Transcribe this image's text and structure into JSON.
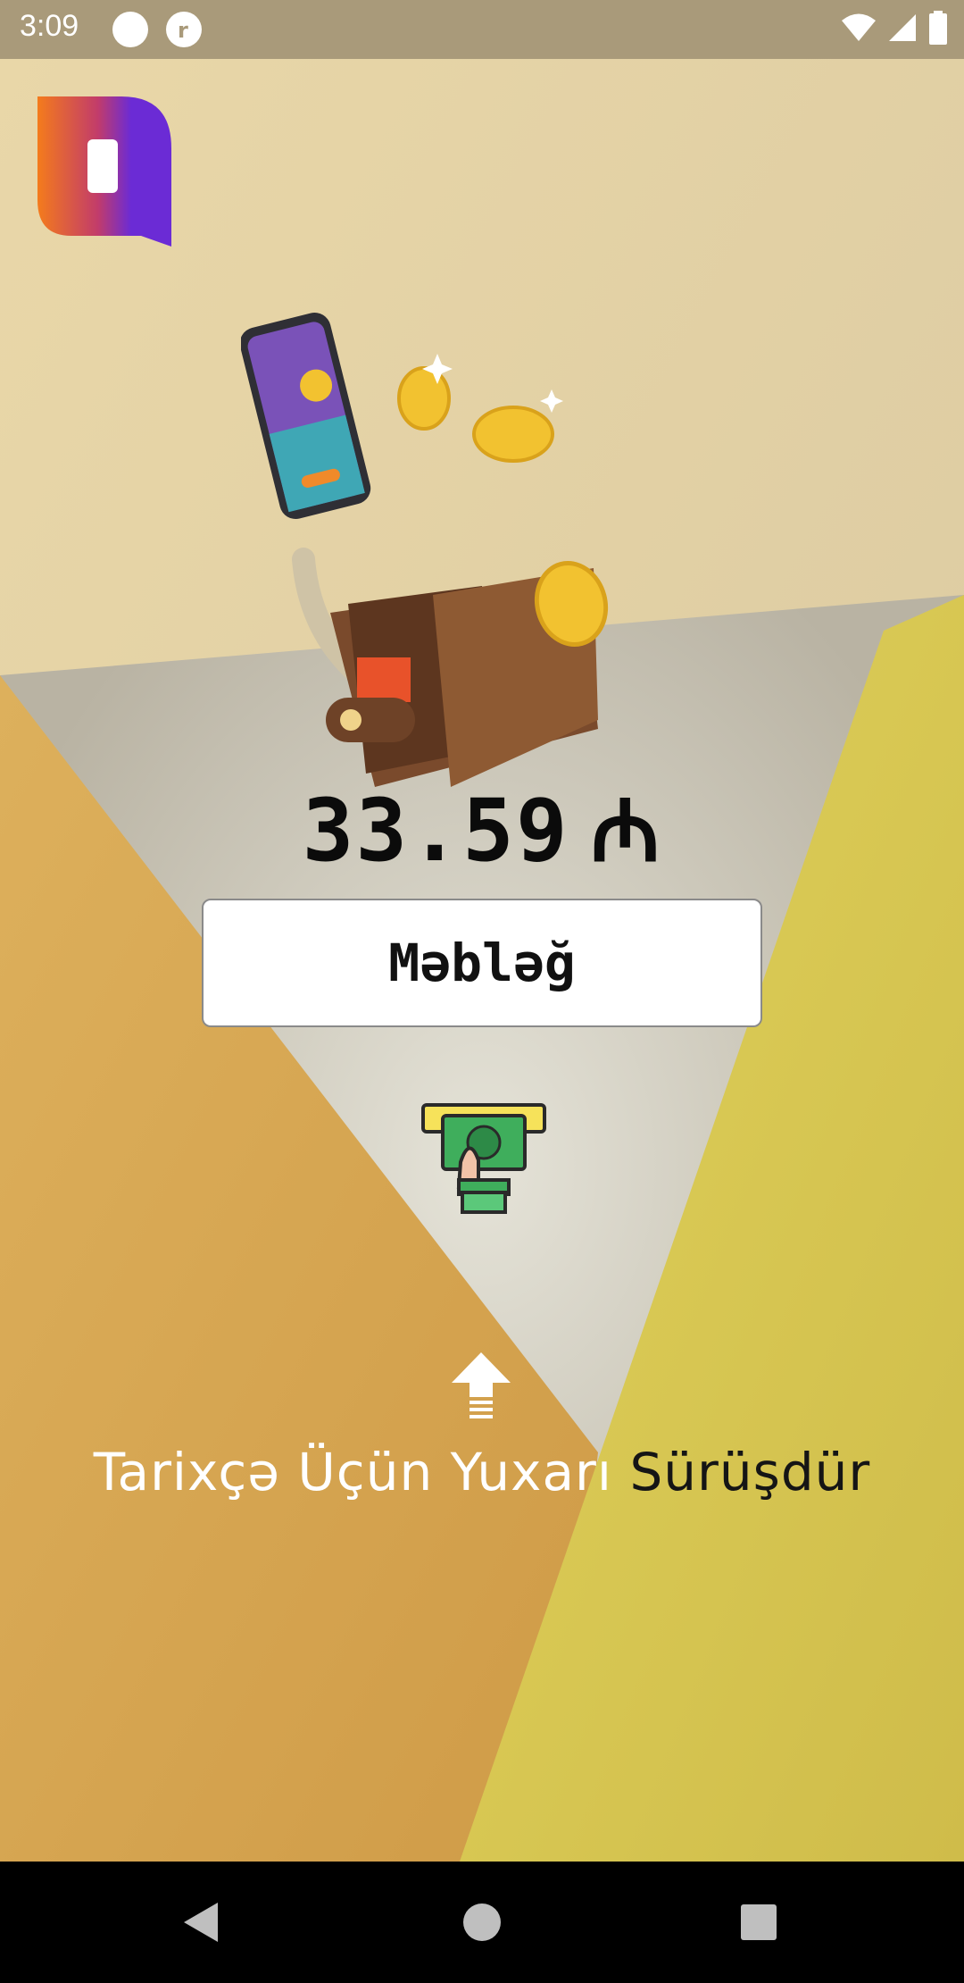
{
  "status_bar": {
    "time": "3:09",
    "icons": [
      "circle-notification-icon",
      "app-notification-icon",
      "wifi-icon",
      "signal-icon",
      "battery-icon"
    ]
  },
  "balance": {
    "amount": "33.59",
    "currency_symbol": "₼"
  },
  "amount_button": {
    "label": "Məbləğ"
  },
  "swipe_hint": {
    "part1": "Tarixçə Üçün Yuxarı",
    "part2": "Sürüşdür"
  },
  "nav_bar": {
    "buttons": [
      "back-icon",
      "home-icon",
      "recents-icon"
    ]
  },
  "colors": {
    "background_cream": "#e6d3a4",
    "orange_panel": "#d9a24f",
    "yellow_panel": "#d8c44d",
    "logo_orange": "#f17a1f",
    "logo_purple": "#6a2bd6"
  }
}
